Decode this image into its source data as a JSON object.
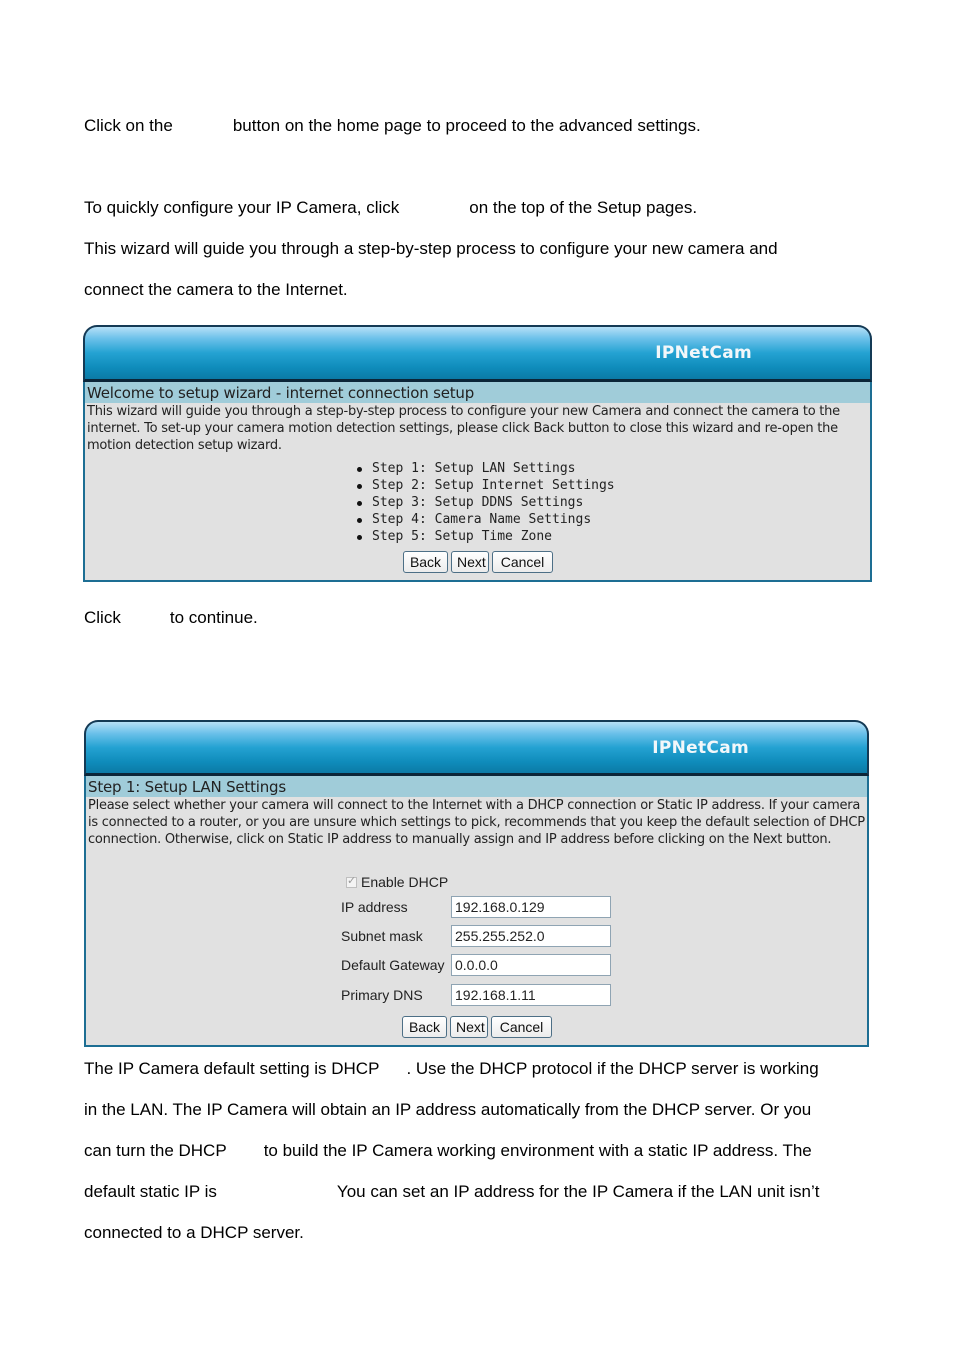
{
  "doc": {
    "para1": {
      "before": "Click on the",
      "after": "button on the home page to proceed to the advanced settings."
    },
    "para2": {
      "before": "To quickly configure your IP Camera, click",
      "after": "on the top of the Setup pages."
    },
    "para3_line1": "This wizard will guide you through a step-by-step process to configure your new camera and",
    "para3_line2": "connect the camera to the Internet.",
    "para4": {
      "before": "Click",
      "after": "to continue."
    },
    "para5": {
      "line1_before": "The IP Camera default setting is DHCP",
      "line1_after": ". Use the DHCP protocol if the DHCP server is working",
      "line2": "in the LAN. The IP Camera will obtain an IP address automatically from the DHCP server. Or you",
      "line3_before": "can turn the DHCP",
      "line3_after": "to build the IP Camera working environment with a static IP address. The",
      "line4_before": "default static IP is",
      "line4_after": "You can set an IP address for the IP Camera if the LAN unit isn’t",
      "line5": "connected to a DHCP server."
    }
  },
  "wizard1": {
    "brand": "IPNetCam",
    "title": "Welcome to setup wizard - internet connection setup",
    "description": "This wizard will guide you through a step-by-step process to configure your new Camera and connect the camera to the internet. To set-up your camera motion detection settings, please click Back button to close this wizard and re-open the motion detection setup wizard.",
    "steps": [
      "Step 1: Setup LAN Settings",
      "Step 2: Setup Internet Settings",
      "Step 3: Setup DDNS Settings",
      "Step 4: Camera Name Settings",
      "Step 5: Setup Time Zone"
    ],
    "buttons": {
      "back": "Back",
      "next": "Next",
      "cancel": "Cancel"
    }
  },
  "wizard2": {
    "brand": "IPNetCam",
    "title": "Step 1: Setup LAN Settings",
    "description": "Please select whether your camera will connect to the Internet with a DHCP connection or Static IP address. If your camera is connected to a router, or you are unsure which settings to pick, recommends that you keep the default selection of DHCP connection. Otherwise, click on Static IP address to manually assign and IP address before clicking on the Next button.",
    "enable_dhcp": {
      "label": "Enable DHCP",
      "checked": true
    },
    "fields": [
      {
        "label": "IP address",
        "value": "192.168.0.129"
      },
      {
        "label": "Subnet mask",
        "value": "255.255.252.0"
      },
      {
        "label": "Default Gateway",
        "value": "0.0.0.0"
      },
      {
        "label": "Primary DNS",
        "value": "192.168.1.11"
      }
    ],
    "buttons": {
      "back": "Back",
      "next": "Next",
      "cancel": "Cancel"
    }
  }
}
